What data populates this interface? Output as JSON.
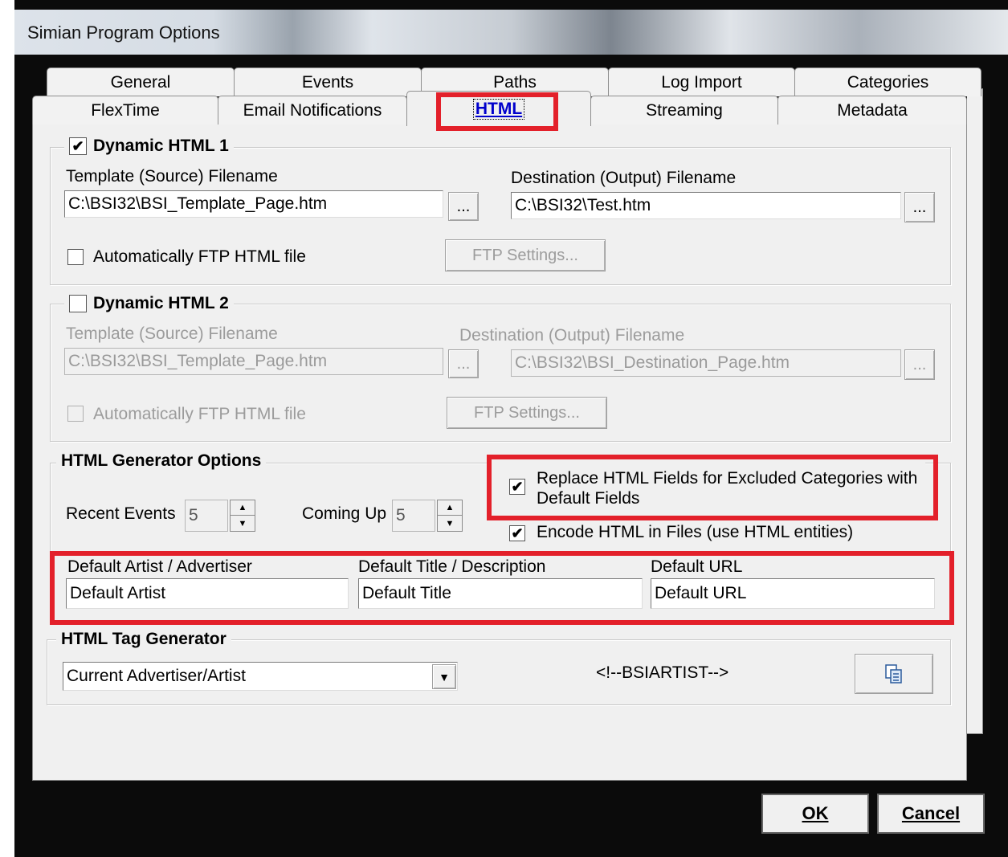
{
  "window": {
    "title": "Simian Program Options"
  },
  "tabs": {
    "row1": [
      "General",
      "Events",
      "Paths",
      "Log Import",
      "Categories"
    ],
    "row2": [
      "FlexTime",
      "Email Notifications",
      "HTML",
      "Streaming",
      "Metadata"
    ],
    "active": "HTML"
  },
  "dynamic_html_1": {
    "title": "Dynamic HTML 1",
    "enabled": true,
    "template_label": "Template (Source) Filename",
    "template_value": "C:\\BSI32\\BSI_Template_Page.htm",
    "dest_label": "Destination (Output) Filename",
    "dest_value": "C:\\BSI32\\Test.htm",
    "browse_label": "...",
    "ftp_checkbox_label": "Automatically FTP HTML file",
    "ftp_checked": false,
    "ftp_button_label": "FTP Settings..."
  },
  "dynamic_html_2": {
    "title": "Dynamic HTML 2",
    "enabled": false,
    "template_label": "Template (Source) Filename",
    "template_value": "C:\\BSI32\\BSI_Template_Page.htm",
    "dest_label": "Destination (Output) Filename",
    "dest_value": "C:\\BSI32\\BSI_Destination_Page.htm",
    "browse_label": "...",
    "ftp_checkbox_label": "Automatically FTP HTML file",
    "ftp_checked": false,
    "ftp_button_label": "FTP Settings..."
  },
  "generator_options": {
    "title": "HTML Generator Options",
    "recent_events_label": "Recent Events",
    "recent_events_value": "5",
    "coming_up_label": "Coming Up",
    "coming_up_value": "5",
    "replace_fields_label_line1": "Replace HTML Fields for Excluded Categories with",
    "replace_fields_label_line2": "Default Fields",
    "replace_fields_checked": true,
    "encode_label": "Encode HTML in Files (use HTML entities)",
    "encode_checked": true,
    "default_artist_label": "Default Artist / Advertiser",
    "default_artist_value": "Default Artist",
    "default_title_label": "Default Title / Description",
    "default_title_value": "Default Title",
    "default_url_label": "Default URL",
    "default_url_value": "Default URL"
  },
  "tag_generator": {
    "title": "HTML Tag Generator",
    "selected": "Current Advertiser/Artist",
    "tag_text": "<!--BSIARTIST-->",
    "copy_icon": "copy-icon"
  },
  "footer": {
    "ok_label": "OK",
    "cancel_label": "Cancel"
  },
  "colors": {
    "highlight": "#e3202a",
    "panel": "#f0f0f0",
    "frame": "#0b0b0b"
  }
}
